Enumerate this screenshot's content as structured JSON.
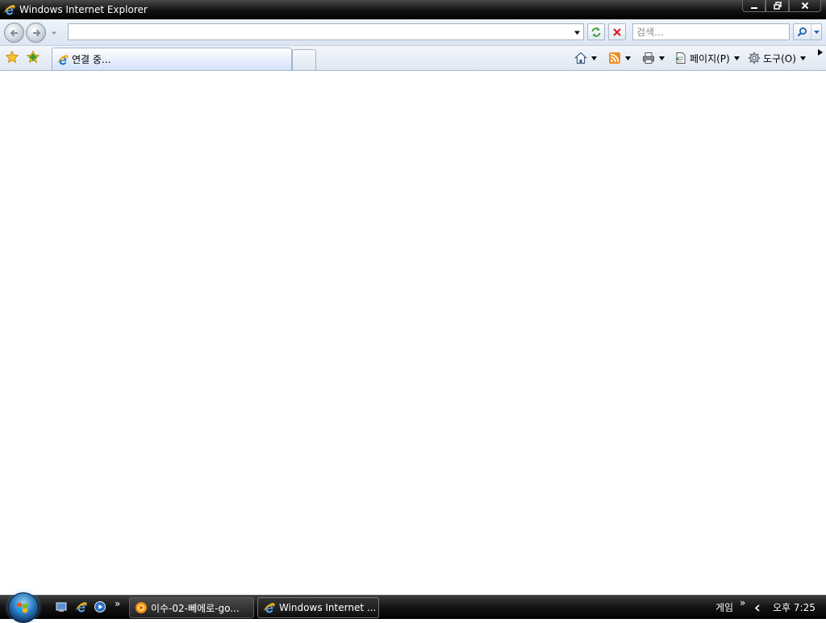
{
  "window": {
    "title": "Windows Internet Explorer"
  },
  "navbar": {
    "address_value": "",
    "search_placeholder": "검색..."
  },
  "tabbar": {
    "active_tab_label": "연결 중...",
    "commands": {
      "page_label": "페이지(P)",
      "tools_label": "도구(O)"
    }
  },
  "taskbar": {
    "buttons": [
      {
        "label": "이수-02-뻬에로-go...",
        "icon": "media-player-icon"
      },
      {
        "label": "Windows Internet ...",
        "icon": "ie-icon"
      }
    ],
    "tray": {
      "toolbar_label": "게임",
      "more_glyph": "»",
      "clock": "오후 7:25"
    }
  },
  "colors": {
    "titlebar": "#111111",
    "toolbar": "#dbe5f2",
    "ie_blue": "#1b6fc7",
    "ie_gold": "#f2b21c",
    "stop_red": "#d42020",
    "refresh_green": "#2f9a2f",
    "feed_orange": "#f28a1c"
  }
}
